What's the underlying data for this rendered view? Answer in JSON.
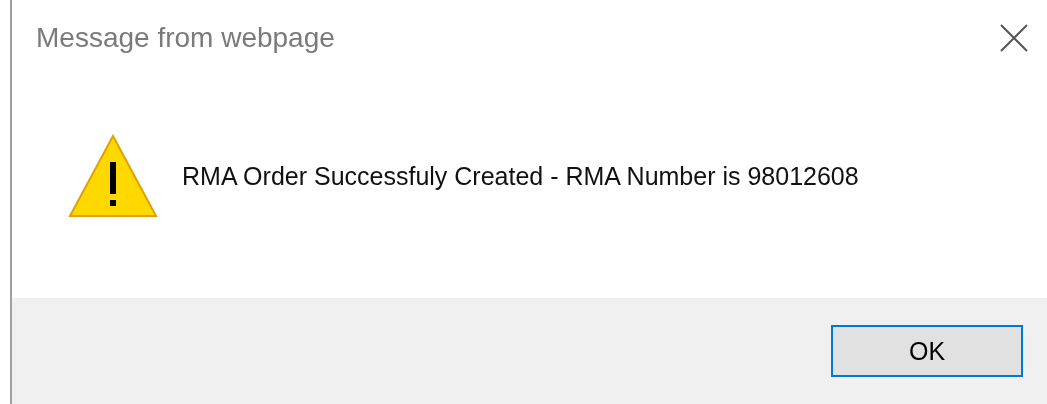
{
  "window": {
    "title": "Message from webpage"
  },
  "message": "RMA Order Successfuly Created - RMA Number is 98012608",
  "buttons": [
    {
      "label": "OK",
      "selected": true
    }
  ]
}
